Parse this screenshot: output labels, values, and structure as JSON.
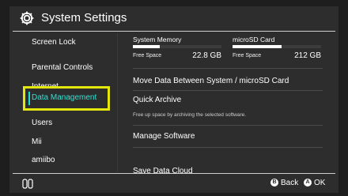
{
  "header": {
    "title": "System Settings"
  },
  "sidebar": {
    "items": [
      {
        "label": "Screen Lock"
      },
      {
        "label": "Parental Controls"
      },
      {
        "label": "Internet"
      },
      {
        "label": "Data Management"
      },
      {
        "label": "Users"
      },
      {
        "label": "Mii"
      },
      {
        "label": "amiibo"
      }
    ]
  },
  "storage": {
    "system": {
      "label": "System Memory",
      "free_label": "Free Space",
      "free_value": "22.8 GB",
      "used_fraction": 0.3
    },
    "sd": {
      "label": "microSD Card",
      "free_label": "Free Space",
      "free_value": "212 GB",
      "used_fraction": 0.55
    }
  },
  "options": {
    "move_data": "Move Data Between System / microSD Card",
    "quick_archive": "Quick Archive",
    "quick_archive_desc": "Free up space by archiving the selected software.",
    "manage_software": "Manage Software",
    "save_data_cloud": "Save Data Cloud"
  },
  "footer": {
    "back_button": "B",
    "back_label": "Back",
    "ok_button": "A",
    "ok_label": "OK"
  },
  "colors": {
    "background": "#2d2d2d",
    "selection_border": "#e6e60f",
    "selection_text": "#2fe2d2"
  }
}
